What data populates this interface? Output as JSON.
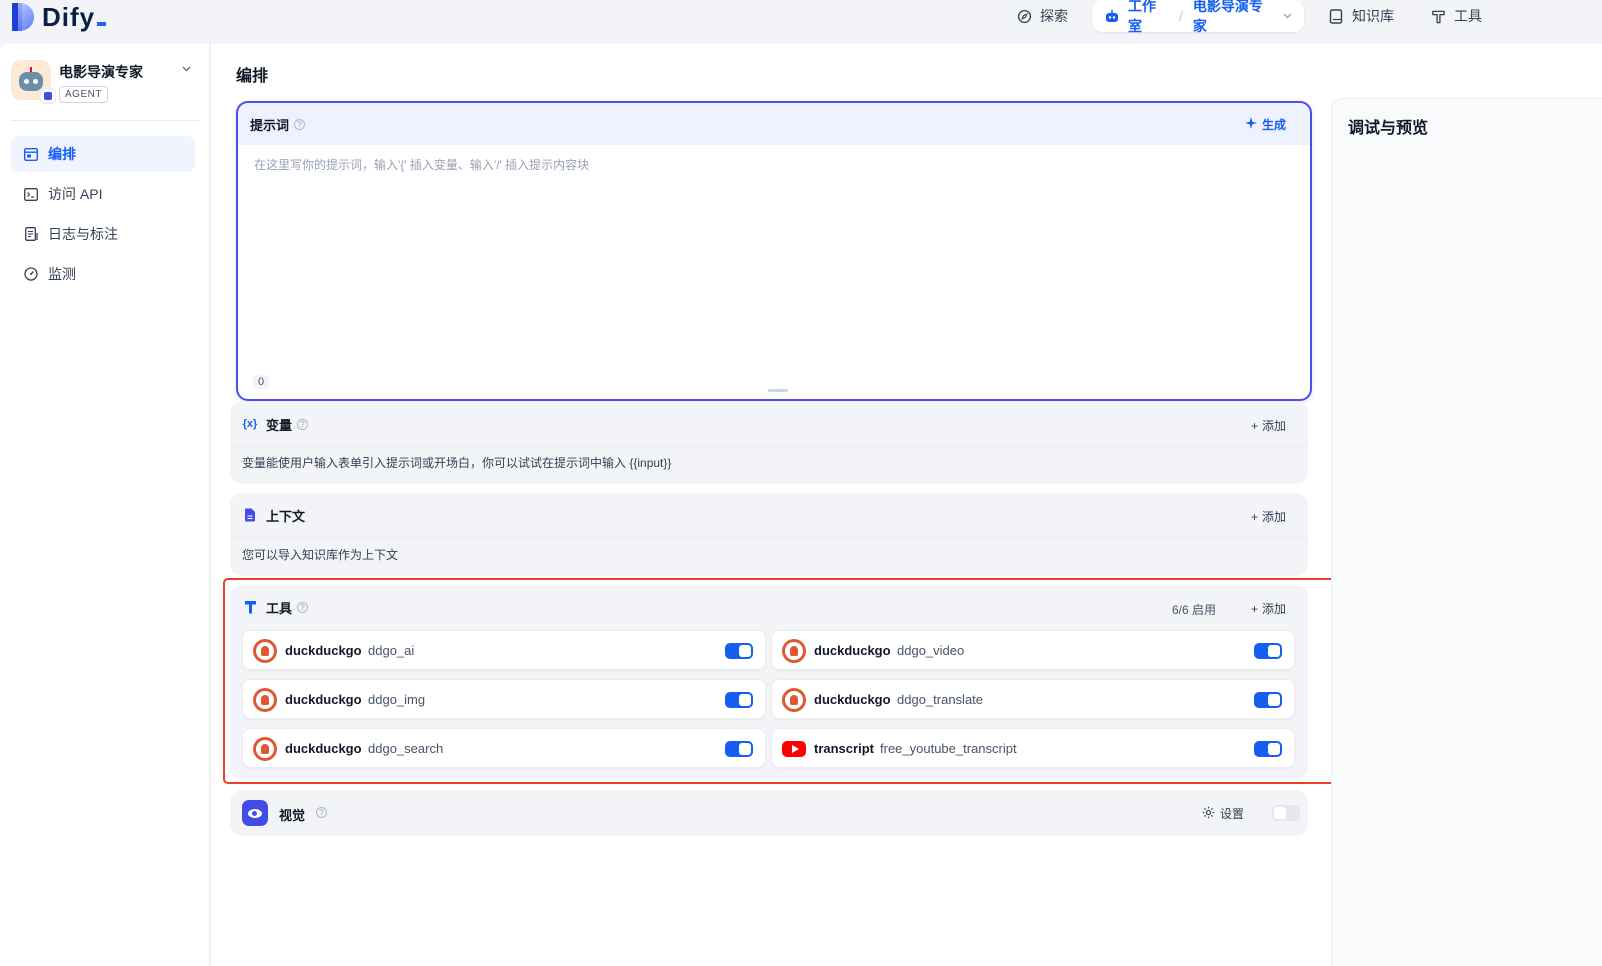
{
  "brand": {
    "name": "Dify"
  },
  "nav": {
    "explore": "探索",
    "studio": "工作室",
    "separator": "/",
    "current_app": "电影导演专家",
    "knowledge": "知识库",
    "tools": "工具"
  },
  "sidebar": {
    "app_name": "电影导演专家",
    "app_type": "AGENT",
    "items": [
      {
        "label": "编排",
        "icon": "layout-icon",
        "active": true
      },
      {
        "label": "访问 API",
        "icon": "terminal-icon",
        "active": false
      },
      {
        "label": "日志与标注",
        "icon": "logs-icon",
        "active": false
      },
      {
        "label": "监测",
        "icon": "gauge-icon",
        "active": false
      }
    ]
  },
  "main": {
    "title": "编排",
    "prompt": {
      "title": "提示词",
      "generate_label": "生成",
      "placeholder": "在这里写你的提示词，输入'{' 插入变量、输入'/' 插入提示内容块",
      "char_count": "0"
    },
    "variables": {
      "title": "变量",
      "icon_text": "{x}",
      "add_label": "添加",
      "description": "变量能使用户输入表单引入提示词或开场白，你可以试试在提示词中输入 {{input}}"
    },
    "context": {
      "title": "上下文",
      "add_label": "添加",
      "description": "您可以导入知识库作为上下文"
    },
    "tools": {
      "title": "工具",
      "count": "6/6 启用",
      "add_label": "添加",
      "items": [
        {
          "provider": "duckduckgo",
          "name": "ddgo_ai",
          "enabled": true,
          "logo": "duckduckgo-icon"
        },
        {
          "provider": "duckduckgo",
          "name": "ddgo_video",
          "enabled": true,
          "logo": "duckduckgo-icon"
        },
        {
          "provider": "duckduckgo",
          "name": "ddgo_img",
          "enabled": true,
          "logo": "duckduckgo-icon"
        },
        {
          "provider": "duckduckgo",
          "name": "ddgo_translate",
          "enabled": true,
          "logo": "duckduckgo-icon"
        },
        {
          "provider": "duckduckgo",
          "name": "ddgo_search",
          "enabled": true,
          "logo": "duckduckgo-icon"
        },
        {
          "provider": "transcript",
          "name": "free_youtube_transcript",
          "enabled": true,
          "logo": "youtube-icon"
        }
      ]
    },
    "vision": {
      "title": "视觉",
      "settings_label": "设置",
      "enabled": false
    }
  },
  "debug": {
    "title": "调试与预览"
  },
  "colors": {
    "accent": "#155eef",
    "prompt_border": "#4b4fe9",
    "highlight": "#e8402a",
    "duckduckgo": "#de5833",
    "youtube": "#ff0000"
  }
}
